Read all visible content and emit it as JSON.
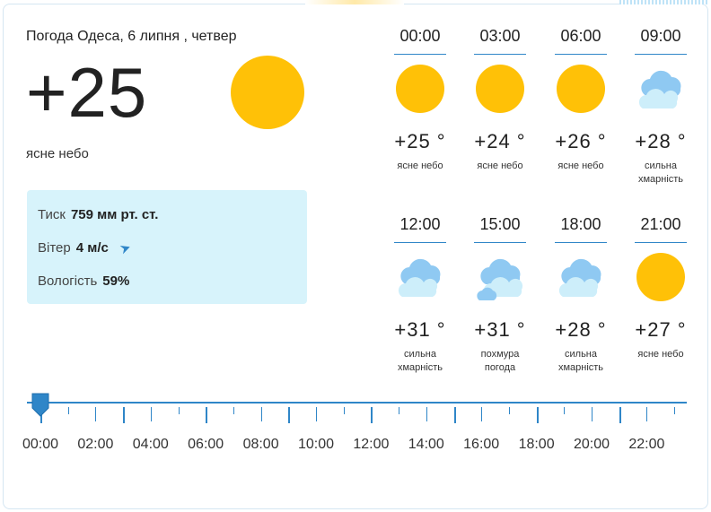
{
  "header": {
    "title": "Погода Одеса, 6 липня , четвер",
    "temperature": "+25",
    "condition": "ясне небо",
    "icon": "sun-icon"
  },
  "details": {
    "pressure_label": "Тиск",
    "pressure_value": "759 мм рт. ст.",
    "wind_label": "Вітер",
    "wind_value": "4 м/с",
    "humidity_label": "Вологість",
    "humidity_value": "59%"
  },
  "hourly": [
    {
      "time": "00:00",
      "temp": "+25 °",
      "desc": "ясне небо",
      "icon": "sun-icon"
    },
    {
      "time": "03:00",
      "temp": "+24 °",
      "desc": "ясне небо",
      "icon": "sun-icon"
    },
    {
      "time": "06:00",
      "temp": "+26 °",
      "desc": "ясне небо",
      "icon": "sun-icon"
    },
    {
      "time": "09:00",
      "temp": "+28 °",
      "desc": "сильна хмарність",
      "icon": "clouds-icon"
    },
    {
      "time": "12:00",
      "temp": "+31 °",
      "desc": "сильна хмарність",
      "icon": "clouds-icon"
    },
    {
      "time": "15:00",
      "temp": "+31 °",
      "desc": "похмура погода",
      "icon": "overcast-icon"
    },
    {
      "time": "18:00",
      "temp": "+28 °",
      "desc": "сильна хмарність",
      "icon": "clouds-icon"
    },
    {
      "time": "21:00",
      "temp": "+27 °",
      "desc": "ясне небо",
      "icon": "sun-icon"
    }
  ],
  "timeline": {
    "labels": [
      "00:00",
      "02:00",
      "04:00",
      "06:00",
      "08:00",
      "10:00",
      "12:00",
      "14:00",
      "16:00",
      "18:00",
      "20:00",
      "22:00"
    ],
    "selected": "00:00"
  },
  "colors": {
    "accent": "#2f86c8",
    "sun": "#ffc107",
    "info_bg": "#d7f3fb",
    "cloud_light": "#cdeefa",
    "cloud_dark": "#8fc9f2"
  }
}
